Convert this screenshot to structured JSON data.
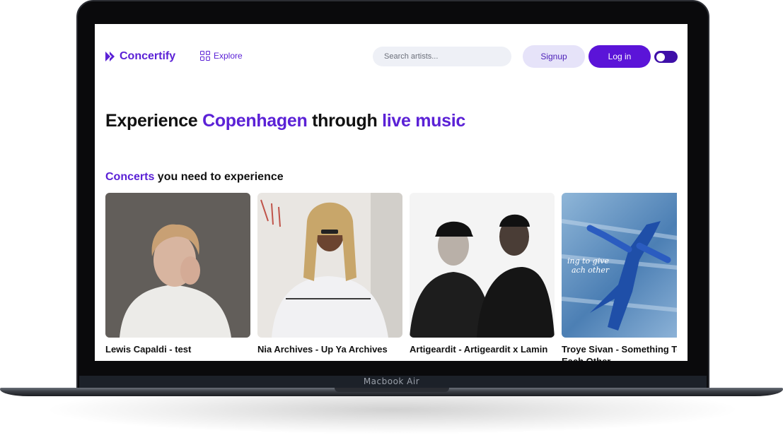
{
  "device": {
    "label": "Macbook Air"
  },
  "nav": {
    "brand": "Concertify",
    "explore_label": "Explore",
    "search_placeholder": "Search artists...",
    "signup_label": "Signup",
    "login_label": "Log in",
    "theme_toggle_on": true
  },
  "hero": {
    "part1": "Experience ",
    "city": "Copenhagen",
    "part2": " through ",
    "highlight": "live music"
  },
  "section": {
    "highlight": "Concerts",
    "rest": " you need to experience"
  },
  "concerts": [
    {
      "title": "Lewis Capaldi - test",
      "image": "artist-photo"
    },
    {
      "title": "Nia Archives - Up Ya Archives",
      "image": "artist-photo"
    },
    {
      "title": "Artigeardit - Artigeardit x Lamin",
      "image": "artist-photo"
    },
    {
      "title": "Troye Sivan - Something To Give Each Other",
      "image": "album-art"
    }
  ],
  "colors": {
    "accent": "#5b21d6",
    "login_bg": "#5b14d8",
    "signup_bg": "#e6e3f9",
    "search_bg": "#eef0f6"
  }
}
